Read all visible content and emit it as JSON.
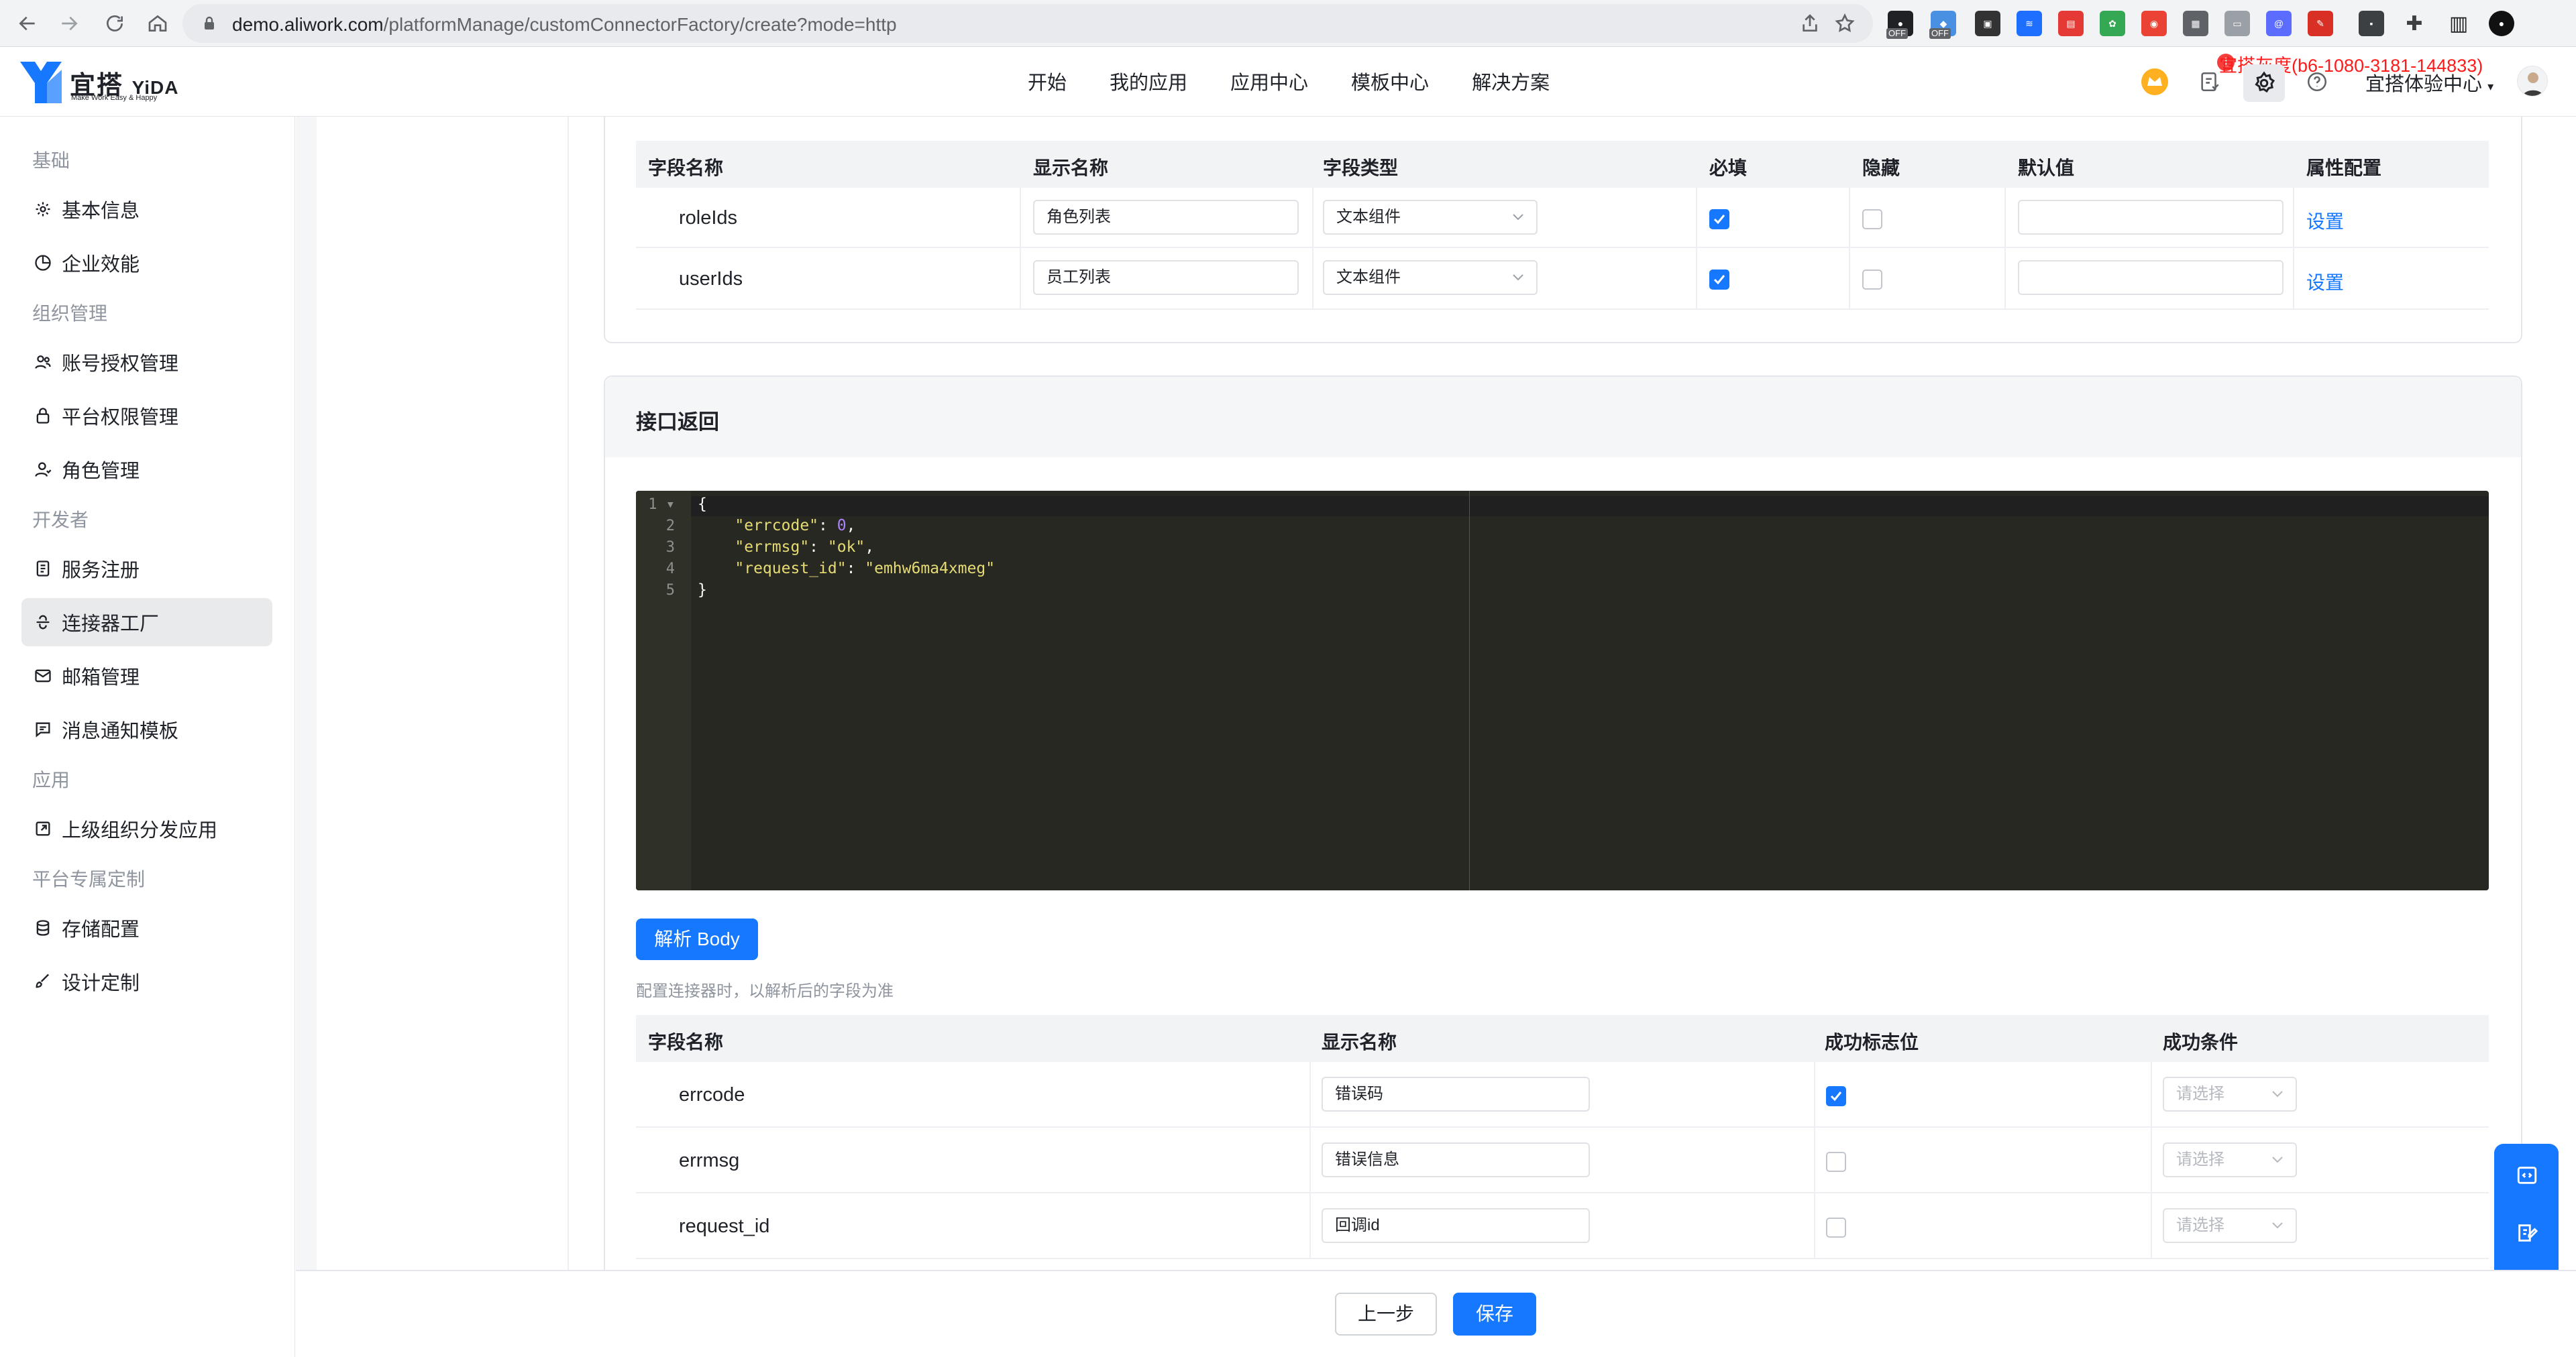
{
  "browser": {
    "url_host": "demo.aliwork.com",
    "url_path": "/platformManage/customConnectorFactory/create?mode=http",
    "ext_off_label": "OFF"
  },
  "header": {
    "logo_cn": "宜搭",
    "logo_en": "YiDA",
    "logo_slogan": "Make Work Easy & Happy",
    "nav": [
      "开始",
      "我的应用",
      "应用中心",
      "模板中心",
      "解决方案"
    ],
    "gray_banner": "宜搭灰度(b6-1080-3181-144833)",
    "gray_dot": "1",
    "org_name": "宜搭体验中心"
  },
  "sidebar": {
    "groups": [
      {
        "label": "基础",
        "items": [
          {
            "label": "基本信息",
            "icon": "gear-icon"
          },
          {
            "label": "企业效能",
            "icon": "chart-icon"
          }
        ]
      },
      {
        "label": "组织管理",
        "items": [
          {
            "label": "账号授权管理",
            "icon": "users-icon"
          },
          {
            "label": "平台权限管理",
            "icon": "lock-icon"
          },
          {
            "label": "角色管理",
            "icon": "user-icon"
          }
        ]
      },
      {
        "label": "开发者",
        "items": [
          {
            "label": "服务注册",
            "icon": "doc-icon"
          },
          {
            "label": "连接器工厂",
            "icon": "connector-icon"
          },
          {
            "label": "邮箱管理",
            "icon": "mail-icon"
          },
          {
            "label": "消息通知模板",
            "icon": "message-icon"
          }
        ]
      },
      {
        "label": "应用",
        "items": [
          {
            "label": "上级组织分发应用",
            "icon": "share-icon"
          }
        ]
      },
      {
        "label": "平台专属定制",
        "items": [
          {
            "label": "存储配置",
            "icon": "database-icon"
          },
          {
            "label": "设计定制",
            "icon": "brush-icon"
          }
        ]
      }
    ],
    "active": "连接器工厂"
  },
  "request_table": {
    "headers": [
      "字段名称",
      "显示名称",
      "字段类型",
      "必填",
      "隐藏",
      "默认值",
      "属性配置"
    ],
    "rows": [
      {
        "field": "roleIds",
        "display": "角色列表",
        "type": "文本组件",
        "required": true,
        "hidden": false,
        "default": "",
        "action": "设置"
      },
      {
        "field": "userIds",
        "display": "员工列表",
        "type": "文本组件",
        "required": true,
        "hidden": false,
        "default": "",
        "action": "设置"
      }
    ]
  },
  "response": {
    "title": "接口返回",
    "code_lines": [
      "{",
      "    \"errcode\": 0,",
      "    \"errmsg\": \"ok\",",
      "    \"request_id\": \"emhw6ma4xmeg\"",
      "}"
    ],
    "code": {
      "errcode_key": "\"errcode\"",
      "errcode_val": "0",
      "errmsg_key": "\"errmsg\"",
      "errmsg_val": "\"ok\"",
      "reqid_key": "\"request_id\"",
      "reqid_val": "\"emhw6ma4xmeg\""
    },
    "parse_button": "解析 Body",
    "hint": "配置连接器时，以解析后的字段为准",
    "headers": [
      "字段名称",
      "显示名称",
      "成功标志位",
      "成功条件"
    ],
    "rows": [
      {
        "field": "errcode",
        "display": "错误码",
        "success_flag": true,
        "condition_placeholder": "请选择"
      },
      {
        "field": "errmsg",
        "display": "错误信息",
        "success_flag": false,
        "condition_placeholder": "请选择"
      },
      {
        "field": "request_id",
        "display": "回调id",
        "success_flag": false,
        "condition_placeholder": "请选择"
      }
    ]
  },
  "footer": {
    "prev": "上一步",
    "save": "保存"
  },
  "colors": {
    "primary": "#1677ff",
    "editor_bg": "#272822",
    "banner_red": "#ff1a1a"
  }
}
